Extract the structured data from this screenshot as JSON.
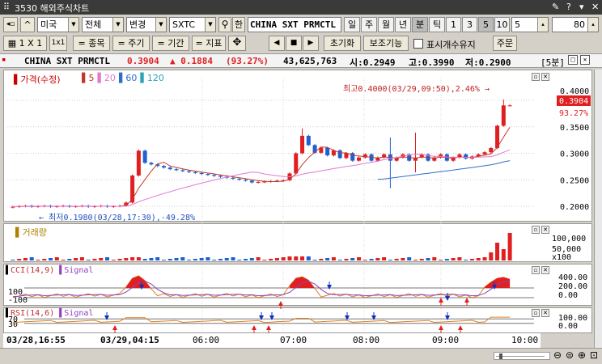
{
  "window": {
    "title": "3530 해외주식차트"
  },
  "toolbar1": {
    "market": "미국",
    "filter": "전체",
    "change_label": "변경",
    "symbol": "SXTC",
    "han_label": "한",
    "name": "CHINA SXT PRMCTL",
    "periods": [
      "일",
      "주",
      "월",
      "년",
      "분",
      "틱"
    ],
    "selected_period": "분",
    "intervals": [
      "1",
      "3",
      "5",
      "10"
    ],
    "selected_interval": "5",
    "interval_value": "5",
    "count_value": "80"
  },
  "toolbar2": {
    "layout_label": "1 X 1",
    "layout_small": "1x1",
    "item_label": "= 종목",
    "cycle_label": "= 주기",
    "period_label": "= 기간",
    "indicator_label": "= 지표",
    "reset_label": "초기화",
    "aux_label": "보조기능",
    "show_count_label": "표시개수유지",
    "order_label": "주문"
  },
  "info": {
    "name": "CHINA SXT PRMCTL",
    "price": "0.3904",
    "change": "▲ 0.1884",
    "change_pct": "(93.27%)",
    "volume": "43,625,763",
    "open": "시:0.2949",
    "high": "고:0.3990",
    "low": "저:0.2900",
    "interval_badge": "[5분]"
  },
  "price_panel": {
    "title": "가격(수정)",
    "ma_legend": [
      {
        "label": "5",
        "color": "#c0392b"
      },
      {
        "label": "20",
        "color": "#e07ad0"
      },
      {
        "label": "60",
        "color": "#2f6fc9"
      },
      {
        "label": "120",
        "color": "#2aa3b8"
      }
    ],
    "high_annotation": "최고0.4000(03/29,09:50),2.46%",
    "low_annotation": "최저0.1980(03/28,17:30),-49.28%",
    "last_price_label": "0.3904",
    "last_pct_label": "93.27%",
    "y_ticks": [
      "0.4000",
      "0.3500",
      "0.3000",
      "0.2500",
      "0.2000"
    ]
  },
  "volume_panel": {
    "title": "거래량",
    "y_ticks": [
      "100,000",
      "50,000",
      "x100"
    ]
  },
  "cci_panel": {
    "title": "CCI(14,9)",
    "signal": "Signal",
    "left_ticks": [
      "100",
      "-100"
    ],
    "y_ticks": [
      "400.00",
      "200.00",
      "0.00"
    ]
  },
  "rsi_panel": {
    "title": "RSI(14,6)",
    "signal": "Signal",
    "left_ticks": [
      "70",
      "30"
    ],
    "y_ticks": [
      "100.00",
      "0.00"
    ]
  },
  "x_axis": [
    "03/28,16:55",
    "03/29,04:15",
    "06:00",
    "07:00",
    "08:00",
    "09:00",
    "10:00"
  ],
  "colors": {
    "up": "#e02020",
    "down": "#2060d0",
    "ma5": "#c0392b",
    "ma20": "#e07ad0",
    "ma60": "#2f6fc9",
    "ma120": "#2aa3b8",
    "last_price_bg": "#e02020"
  },
  "icons": [
    "pin-icon",
    "help-icon",
    "menu-icon",
    "close-icon",
    "crosshair-icon",
    "prev-icon",
    "stop-icon",
    "next-icon",
    "zoom-out-icon",
    "zoom-reset-icon",
    "zoom-in-icon",
    "zoom-fit-icon"
  ]
}
